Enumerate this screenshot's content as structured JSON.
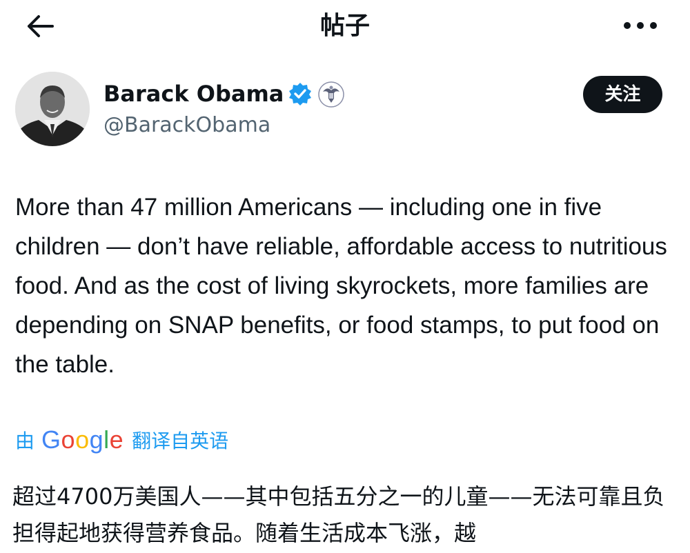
{
  "header": {
    "title": "帖子",
    "back_icon": "back-arrow-icon",
    "more_icon": "more-dots-icon"
  },
  "author": {
    "name": "Barack Obama",
    "handle": "@BarackObama",
    "verified_icon": "verified-badge-icon",
    "affiliation_icon": "government-seal-icon",
    "follow_label": "关注"
  },
  "tweet": {
    "text": "More than 47 million Americans — including one in five children — don’t have reliable, affordable access to nutritious food. And as the cost of living skyrockets, more families are depending on SNAP benefits, or food stamps, to put food on the table."
  },
  "translation": {
    "prefix": "由",
    "provider": "Google",
    "suffix": "翻译自英语",
    "text": "超过4700万美国人——其中包括五分之一的儿童——无法可靠且负担得起地获得营养食品。随着生活成本飞涨，越"
  },
  "colors": {
    "text": "#0f1419",
    "secondary": "#536471",
    "link": "#1d9bf0",
    "verified": "#1d9bf0",
    "button_bg": "#0f1419"
  }
}
